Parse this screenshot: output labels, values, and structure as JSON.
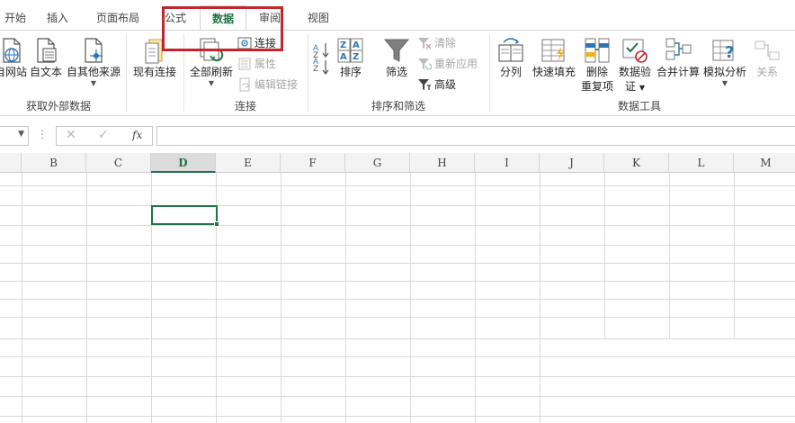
{
  "tabs": [
    {
      "label": "开始",
      "active": false
    },
    {
      "label": "插入",
      "active": false
    },
    {
      "label": "页面布局",
      "active": false
    },
    {
      "label": "公式",
      "active": false
    },
    {
      "label": "数据",
      "active": true
    },
    {
      "label": "审阅",
      "active": false
    },
    {
      "label": "视图",
      "active": false
    }
  ],
  "ribbon": {
    "groups": {
      "get_external": "获取外部数据",
      "connections": "连接",
      "sort_filter": "排序和筛选",
      "data_tools": "数据工具"
    },
    "get_external": {
      "from_web": "自网站",
      "from_text": "自文本",
      "from_other": "自其他来源",
      "existing": "现有连接"
    },
    "connections": {
      "refresh_all": "全部刷新",
      "connections": "连接",
      "properties": "属性",
      "edit_links": "编辑链接"
    },
    "sort_filter": {
      "sort": "排序",
      "filter": "筛选",
      "clear": "清除",
      "reapply": "重新应用",
      "advanced": "高级"
    },
    "data_tools": {
      "text_to_columns": "分列",
      "flash_fill": "快速填充",
      "remove_dup_1": "删除",
      "remove_dup_2": "重复项",
      "validation_1": "数据验",
      "validation_2": "证",
      "consolidate": "合并计算",
      "what_if": "模拟分析",
      "relationships": "关系"
    }
  },
  "formula_bar": {
    "fx_label": "fx",
    "cancel": "✕",
    "enter": "✓",
    "dots": "⋮",
    "value": ""
  },
  "sheet": {
    "columns": [
      "B",
      "C",
      "D",
      "E",
      "F",
      "G",
      "H",
      "I",
      "J",
      "K",
      "L",
      "M"
    ],
    "selected_column": "D"
  },
  "colors": {
    "accent_green": "#217346",
    "highlight_red": "#c0272d"
  }
}
